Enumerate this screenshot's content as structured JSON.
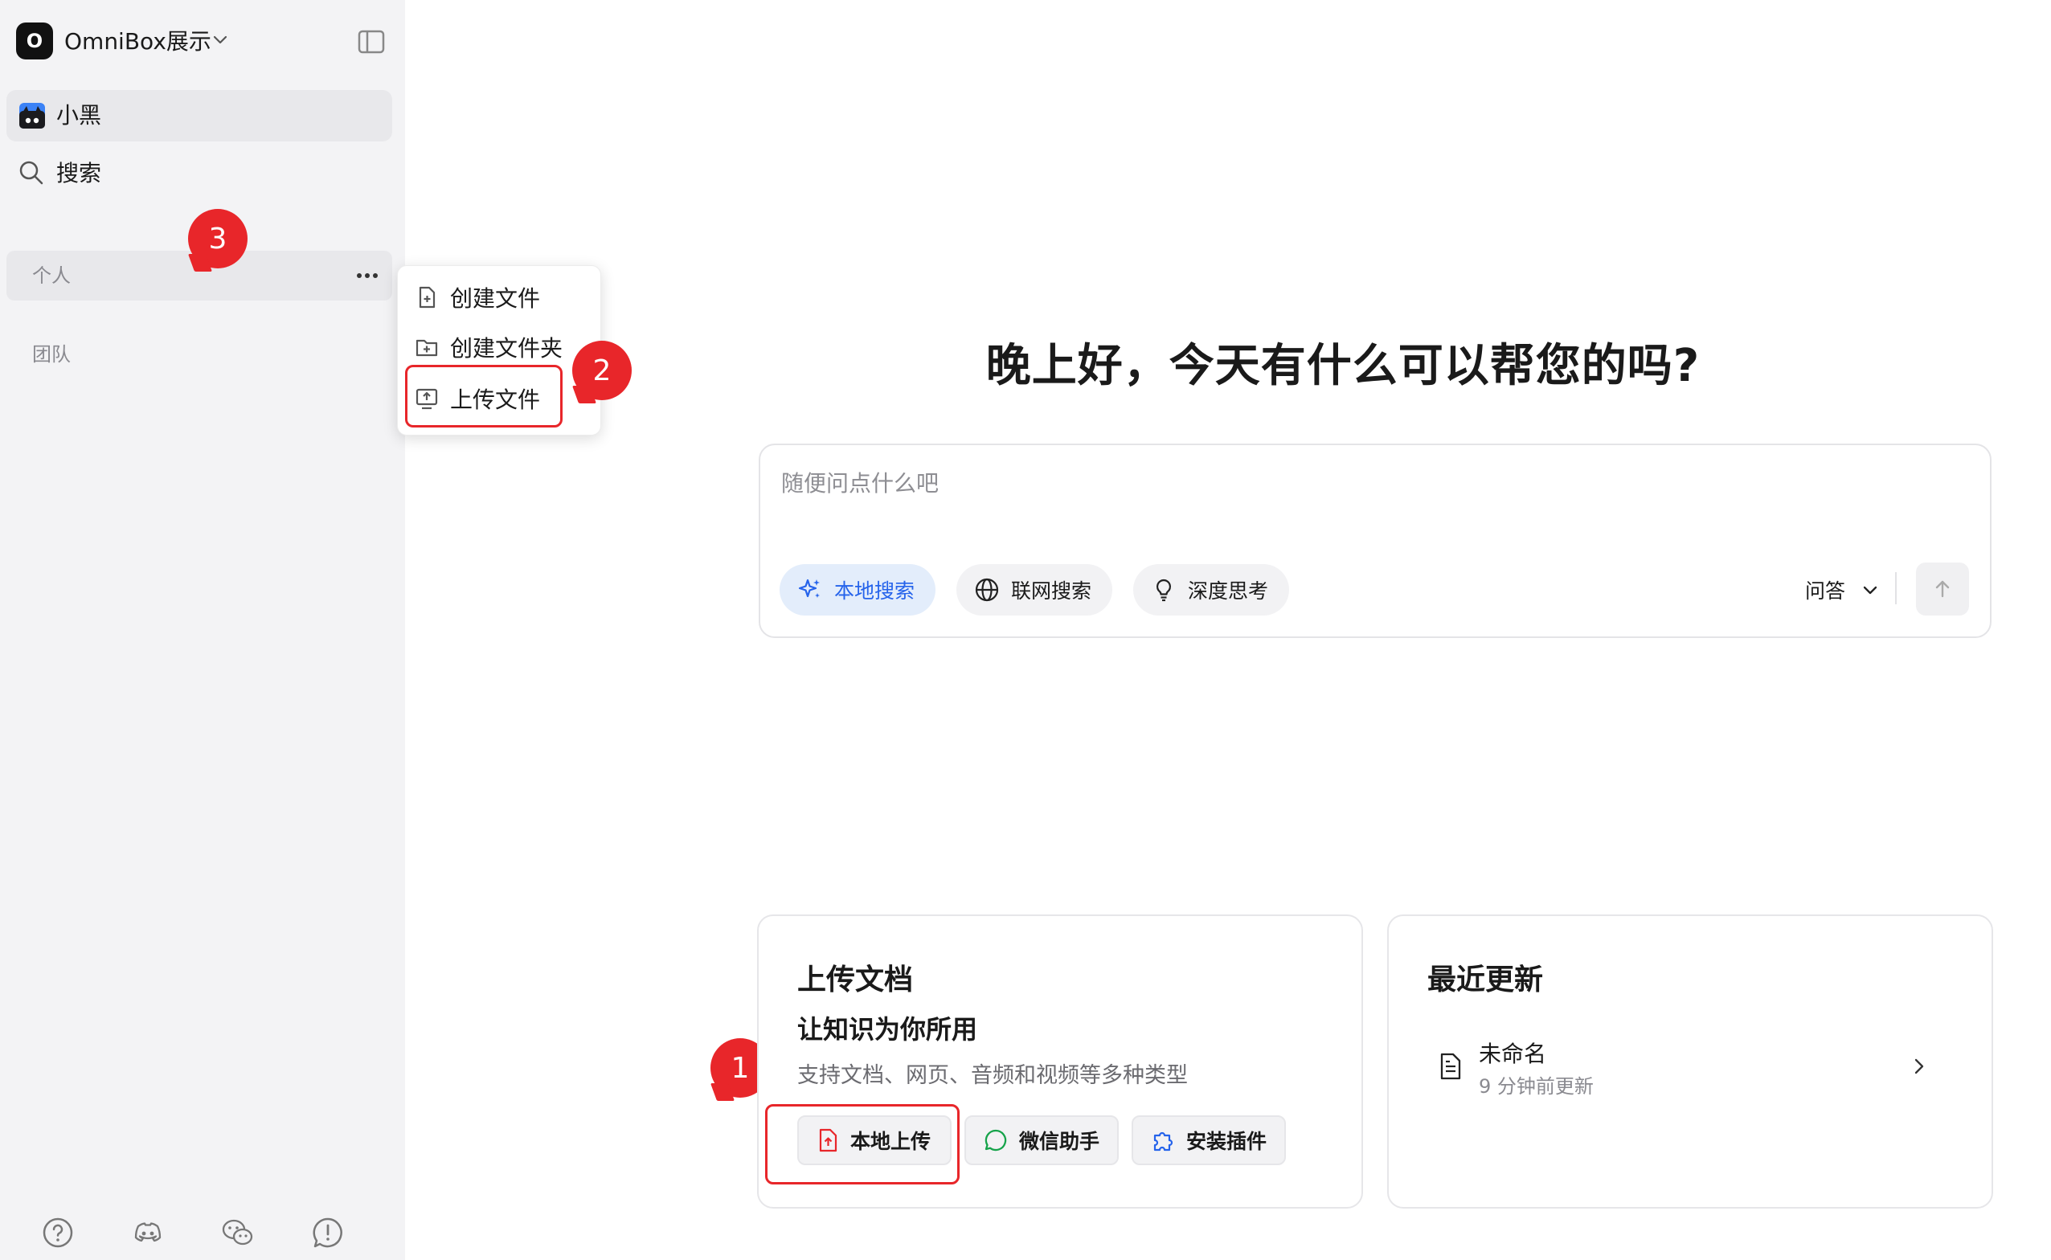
{
  "workspace": {
    "logo_letter": "O",
    "name": "OmniBox展示"
  },
  "sidebar": {
    "user_name": "小黑",
    "search_label": "搜索",
    "sections": [
      {
        "label": "个人"
      },
      {
        "label": "团队"
      }
    ],
    "footer_icons": [
      "help-icon",
      "discord-icon",
      "wechat-icon",
      "feedback-icon"
    ]
  },
  "context_menu": {
    "items": [
      {
        "label": "创建文件",
        "icon": "file-plus-icon"
      },
      {
        "label": "创建文件夹",
        "icon": "folder-plus-icon"
      },
      {
        "label": "上传文件",
        "icon": "upload-icon"
      }
    ]
  },
  "annotations": {
    "step1": "1",
    "step2": "2",
    "step3": "3",
    "color": "#e8262a"
  },
  "main": {
    "greeting": "晚上好，今天有什么可以帮您的吗?",
    "chat_placeholder": "随便问点什么吧",
    "pills": [
      {
        "label": "本地搜索",
        "active": true
      },
      {
        "label": "联网搜索",
        "active": false
      },
      {
        "label": "深度思考",
        "active": false
      }
    ],
    "mode_label": "问答"
  },
  "upload_card": {
    "title": "上传文档",
    "subtitle": "让知识为你所用",
    "description": "支持文档、网页、音频和视频等多种类型",
    "buttons": [
      {
        "label": "本地上传"
      },
      {
        "label": "微信助手"
      },
      {
        "label": "安装插件"
      }
    ]
  },
  "recent_card": {
    "title": "最近更新",
    "items": [
      {
        "title": "未命名",
        "time": "9 分钟前更新"
      }
    ]
  },
  "colors": {
    "accent": "#2563eb",
    "callout_red": "#e8262a",
    "sidebar_bg": "#f3f3f5"
  }
}
